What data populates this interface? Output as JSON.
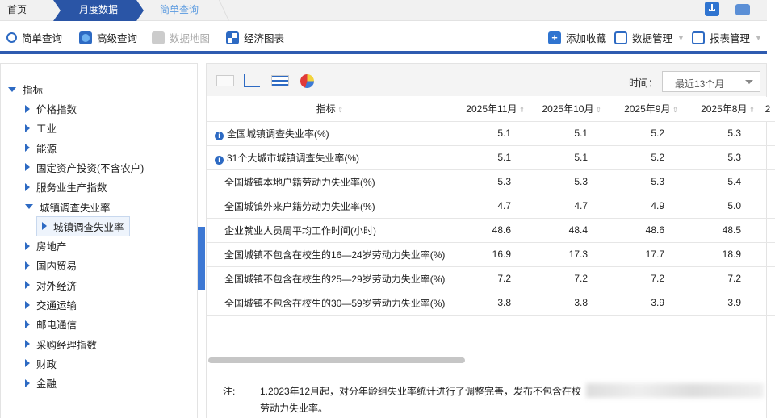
{
  "breadcrumb": {
    "items": [
      "首页",
      "月度数据",
      "简单查询"
    ]
  },
  "toolbar": {
    "simple_query": "简单查询",
    "advanced_query": "高级查询",
    "data_map": "数据地图",
    "econ_chart": "经济图表",
    "add_fav": "添加收藏",
    "data_mgmt": "数据管理",
    "report_mgmt": "报表管理"
  },
  "tree": {
    "root": "指标",
    "items": [
      "价格指数",
      "工业",
      "能源",
      "固定资产投资(不含农户)",
      "服务业生产指数",
      "城镇调查失业率",
      "房地产",
      "国内贸易",
      "对外经济",
      "交通运输",
      "邮电通信",
      "采购经理指数",
      "财政",
      "金融"
    ],
    "sub": "城镇调查失业率"
  },
  "time": {
    "label": "时间：",
    "value": "最近13个月"
  },
  "table": {
    "headers": [
      "指标",
      "2025年11月",
      "2025年10月",
      "2025年9月",
      "2025年8月",
      "2"
    ],
    "rows": [
      {
        "name": "全国城镇调查失业率(%)",
        "info": true,
        "values": [
          "5.1",
          "5.1",
          "5.2",
          "5.3"
        ]
      },
      {
        "name": "31个大城市城镇调查失业率(%)",
        "info": true,
        "values": [
          "5.1",
          "5.1",
          "5.2",
          "5.3"
        ]
      },
      {
        "name": "全国城镇本地户籍劳动力失业率(%)",
        "values": [
          "5.3",
          "5.3",
          "5.3",
          "5.4"
        ]
      },
      {
        "name": "全国城镇外来户籍劳动力失业率(%)",
        "values": [
          "4.7",
          "4.7",
          "4.9",
          "5.0"
        ]
      },
      {
        "name": "企业就业人员周平均工作时间(小时)",
        "values": [
          "48.6",
          "48.4",
          "48.6",
          "48.5"
        ]
      },
      {
        "name": "全国城镇不包含在校生的16—24岁劳动力失业率(%)",
        "values": [
          "16.9",
          "17.3",
          "17.7",
          "18.9"
        ]
      },
      {
        "name": "全国城镇不包含在校生的25—29岁劳动力失业率(%)",
        "values": [
          "7.2",
          "7.2",
          "7.2",
          "7.2"
        ]
      },
      {
        "name": "全国城镇不包含在校生的30—59岁劳动力失业率(%)",
        "values": [
          "3.8",
          "3.8",
          "3.9",
          "3.9"
        ]
      }
    ]
  },
  "note": {
    "label": "注:",
    "line1": "1.2023年12月起，对分年龄组失业率统计进行了调整完善，发布不包含在校",
    "line2": "劳动力失业率。"
  }
}
